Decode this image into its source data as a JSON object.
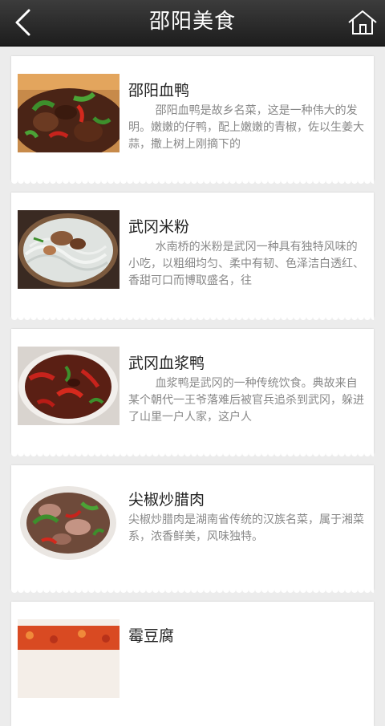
{
  "header": {
    "title": "邵阳美食"
  },
  "items": [
    {
      "title": "邵阳血鸭",
      "desc": "邵阳血鸭是故乡名菜，这是一种伟大的发明。嫩嫩的仔鸭，配上嫩嫩的青椒，佐以生姜大蒜，撒上树上刚摘下的",
      "indent": true
    },
    {
      "title": "武冈米粉",
      "desc": "水南桥的米粉是武冈一种具有独特风味的小吃，以粗细均匀、柔中有韧、色泽洁白透红、香甜可口而博取盛名，往",
      "indent": true
    },
    {
      "title": "武冈血浆鸭",
      "desc": "血浆鸭是武冈的一种传统饮食。典故来自某个朝代一王爷落难后被官兵追杀到武冈，躲进了山里一户人家，这户人",
      "indent": true
    },
    {
      "title": "尖椒炒腊肉",
      "desc": "尖椒炒腊肉是湖南省传统的汉族名菜，属于湘菜系，浓香鲜美，风味独特。",
      "indent": false
    },
    {
      "title": "霉豆腐",
      "desc": "",
      "indent": false
    }
  ]
}
